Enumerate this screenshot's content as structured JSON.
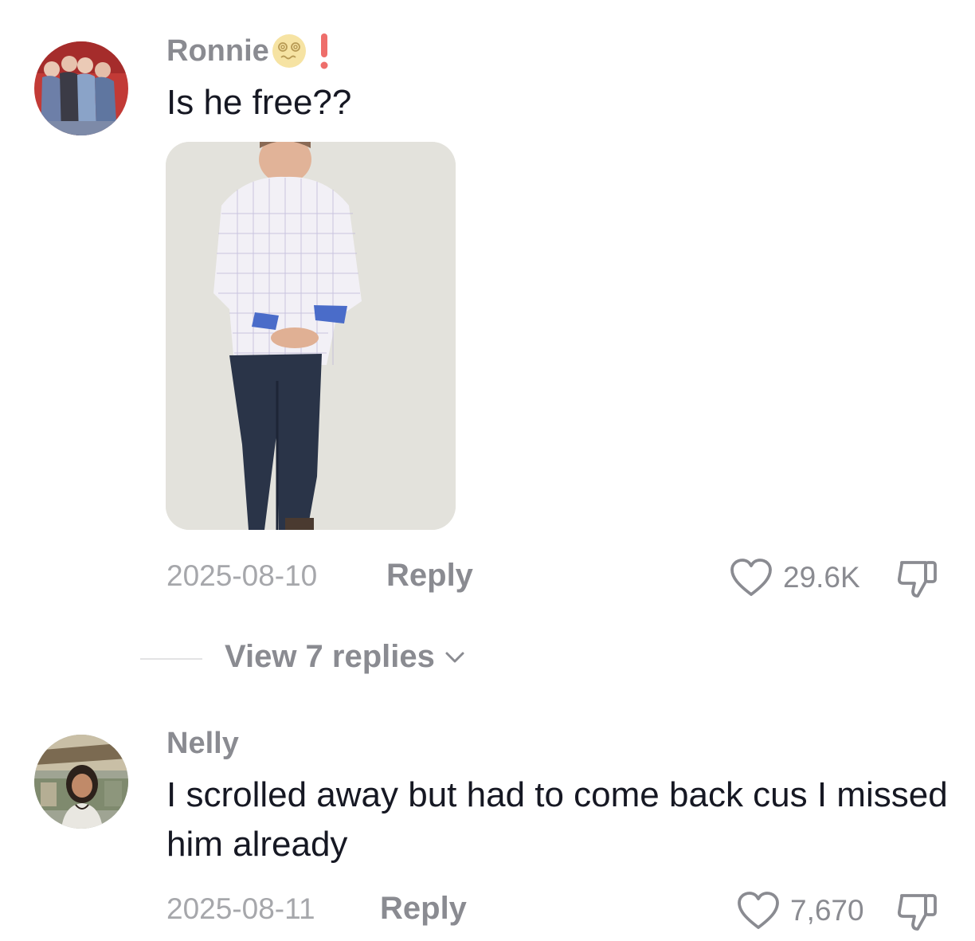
{
  "comments": [
    {
      "username": "Ronnie",
      "username_emoji": "😵‍💫",
      "username_badge": "!",
      "text": "Is he free??",
      "has_photo": true,
      "date": "2025-08-10",
      "reply_label": "Reply",
      "likes": "29.6K",
      "view_replies_label": "View 7 replies"
    },
    {
      "username": "Nelly",
      "text": "I scrolled away but had to come back cus I missed him already",
      "date": "2025-08-11",
      "reply_label": "Reply",
      "likes": "7,670"
    }
  ],
  "icons": {
    "like": "heart-outline-icon",
    "dislike": "thumbs-down-icon",
    "expand": "chevron-down-icon"
  },
  "colors": {
    "text_primary": "#161823",
    "text_secondary": "#8a8b91",
    "text_tertiary": "#a6a7ab",
    "badge_red": "#ee6e6b"
  }
}
